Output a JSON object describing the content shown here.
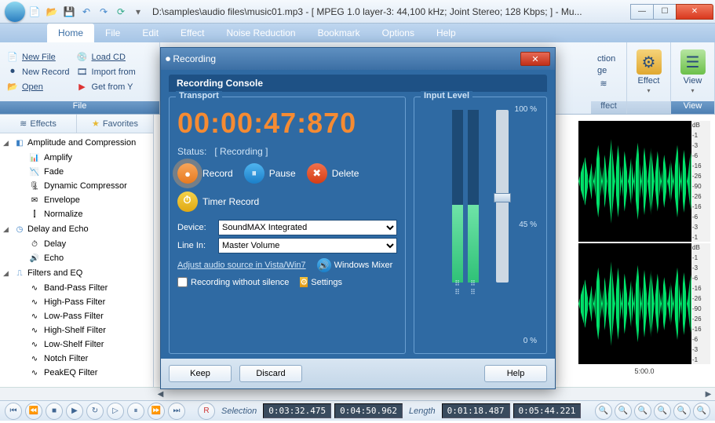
{
  "title_path": "D:\\samples\\audio files\\music01.mp3 - [ MPEG 1.0 layer-3: 44,100 kHz; Joint Stereo; 128 Kbps;  ] - Mu...",
  "menu": {
    "items": [
      "Home",
      "File",
      "Edit",
      "Effect",
      "Noise Reduction",
      "Bookmark",
      "Options",
      "Help"
    ],
    "active": 0
  },
  "ribbon": {
    "file_group_label": "File",
    "file_col1": [
      {
        "icon": "📄",
        "label": "New File"
      },
      {
        "icon": "⏺",
        "label": "New Record"
      },
      {
        "icon": "📂",
        "label": "Open"
      }
    ],
    "file_col2": [
      {
        "icon": "💿",
        "label": "Load CD"
      },
      {
        "icon": "🎞",
        "label": "Import from"
      },
      {
        "icon": "▶",
        "label": "Get from Y"
      }
    ],
    "right_partial": {
      "ction": "ction",
      "ge": "ge"
    },
    "effect_label": "ffect",
    "effect": "Effect",
    "view_label": "View",
    "view": "View"
  },
  "sidebar": {
    "tabs": [
      {
        "icon": "≋",
        "label": "Effects"
      },
      {
        "icon": "★",
        "label": "Favorites"
      }
    ],
    "groups": [
      {
        "label": "Amplitude and Compression",
        "icon": "◧",
        "items": [
          {
            "icon": "📊",
            "label": "Amplify"
          },
          {
            "icon": "📉",
            "label": "Fade"
          },
          {
            "icon": "🗜",
            "label": "Dynamic Compressor"
          },
          {
            "icon": "✉",
            "label": "Envelope"
          },
          {
            "icon": "⫿",
            "label": "Normalize"
          }
        ]
      },
      {
        "label": "Delay and Echo",
        "icon": "◷",
        "items": [
          {
            "icon": "⏱",
            "label": "Delay"
          },
          {
            "icon": "🔊",
            "label": "Echo"
          }
        ]
      },
      {
        "label": "Filters and EQ",
        "icon": "⎍",
        "items": [
          {
            "icon": "∿",
            "label": "Band-Pass Filter"
          },
          {
            "icon": "∿",
            "label": "High-Pass Filter"
          },
          {
            "icon": "∿",
            "label": "Low-Pass Filter"
          },
          {
            "icon": "∿",
            "label": "High-Shelf Filter"
          },
          {
            "icon": "∿",
            "label": "Low-Shelf Filter"
          },
          {
            "icon": "∿",
            "label": "Notch Filter"
          },
          {
            "icon": "∿",
            "label": "PeakEQ Filter"
          }
        ]
      }
    ]
  },
  "db_ticks": [
    "dB",
    "-1",
    "-3",
    "-6",
    "-16",
    "-26",
    "-90",
    "-26",
    "-16",
    "-6",
    "-3",
    "-1"
  ],
  "time_tick": "5:00.0",
  "transport_bar": {
    "selection_label": "Selection",
    "sel_start": "0:03:32.475",
    "sel_end": "0:04:50.962",
    "length_label": "Length",
    "len1": "0:01:18.487",
    "len2": "0:05:44.221"
  },
  "dialog": {
    "title": "Recording",
    "console": "Recording Console",
    "transport_legend": "Transport",
    "input_legend": "Input Level",
    "timer": "00:00:47:870",
    "status_label": "Status:",
    "status_value": "[ Recording ]",
    "btn_record": "Record",
    "btn_pause": "Pause",
    "btn_delete": "Delete",
    "btn_timer": "Timer Record",
    "device_label": "Device:",
    "device_value": "SoundMAX Integrated",
    "linein_label": "Line In:",
    "linein_value": "Master Volume",
    "adjust_link": "Adjust audio source in Vista/Win7",
    "win_mixer": "Windows Mixer",
    "chk_silence": "Recording without silence",
    "settings": "Settings",
    "pct_top": "100 %",
    "pct_mid": "45 %",
    "pct_bot": "0 %",
    "keep": "Keep",
    "discard": "Discard",
    "help": "Help"
  }
}
